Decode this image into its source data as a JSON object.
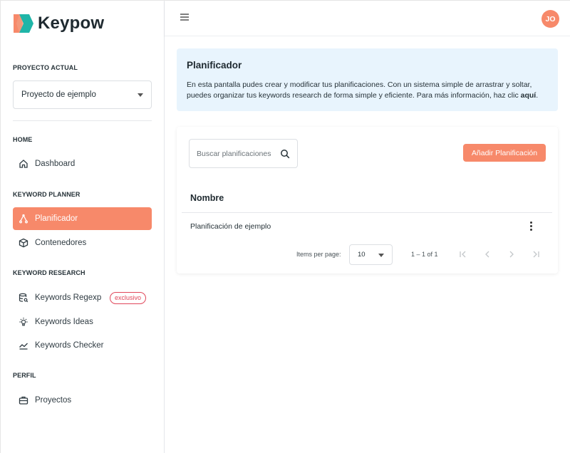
{
  "app": {
    "brand": "Keypow",
    "accent_color": "#f7896a"
  },
  "sidebar": {
    "current_project_label": "PROYECTO ACTUAL",
    "project_selected": "Proyecto de ejemplo",
    "sections": {
      "home": "HOME",
      "keyword_planner": "KEYWORD PLANNER",
      "keyword_research": "KEYWORD RESEARCH",
      "perfil": "PERFIL"
    },
    "items": {
      "dashboard": {
        "label": "Dashboard",
        "icon": "home-icon"
      },
      "planificador": {
        "label": "Planificador",
        "icon": "route-icon",
        "active": true
      },
      "contenedores": {
        "label": "Contenedores",
        "icon": "box-icon"
      },
      "keywords_regexp": {
        "label": "Keywords Regexp",
        "icon": "database-search-icon",
        "badge": "exclusivo"
      },
      "keywords_ideas": {
        "label": "Keywords Ideas",
        "icon": "lightbulb-icon"
      },
      "keywords_checker": {
        "label": "Keywords Checker",
        "icon": "trend-icon"
      },
      "proyectos": {
        "label": "Proyectos",
        "icon": "briefcase-icon"
      }
    }
  },
  "header": {
    "avatar_initials": "JO",
    "menu_icon": "hamburger-icon"
  },
  "info": {
    "title": "Planificador",
    "text": "En esta pantalla pudes crear y modificar tus planificaciones. Con un sistema simple de arrastrar y soltar, puedes organizar tus keywords research de forma simple y eficiente. Para más información, haz clic ",
    "link": "aquí",
    "end": "."
  },
  "planner_card": {
    "search_placeholder": "Buscar planificaciones",
    "add_button": "Añadir Planificación",
    "column_name": "Nombre",
    "rows": [
      {
        "name": "Planificación de ejemplo"
      }
    ],
    "paginator": {
      "items_per_page_label": "Items per page:",
      "items_per_page": "10",
      "range": "1 – 1 of 1"
    }
  }
}
